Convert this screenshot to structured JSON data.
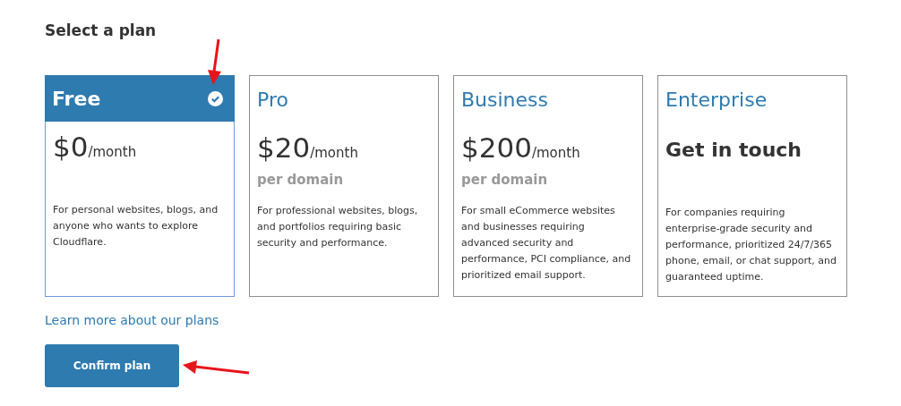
{
  "heading": "Select a plan",
  "plans": [
    {
      "kind": "priced",
      "name": "Free",
      "selected": true,
      "price": "$0",
      "period": "/month",
      "description": "For personal websites, blogs, and anyone who wants to explore Cloudflare."
    },
    {
      "kind": "priced",
      "name": "Pro",
      "selected": false,
      "price": "$20",
      "period": "/month",
      "note": "per domain",
      "description": "For professional websites, blogs, and portfolios requiring basic security and performance."
    },
    {
      "kind": "priced",
      "name": "Business",
      "selected": false,
      "price": "$200",
      "period": "/month",
      "note": "per domain",
      "description": "For small eCommerce websites and businesses requiring advanced security and performance, PCI compliance, and prioritized email support."
    },
    {
      "kind": "contact",
      "name": "Enterprise",
      "selected": false,
      "contact": "Get in touch",
      "description": "For companies requiring enterprise-grade security and performance, prioritized 24/7/365 phone, email, or chat support, and guaranteed uptime."
    }
  ],
  "link": "Learn more about our plans",
  "button": "Confirm plan"
}
